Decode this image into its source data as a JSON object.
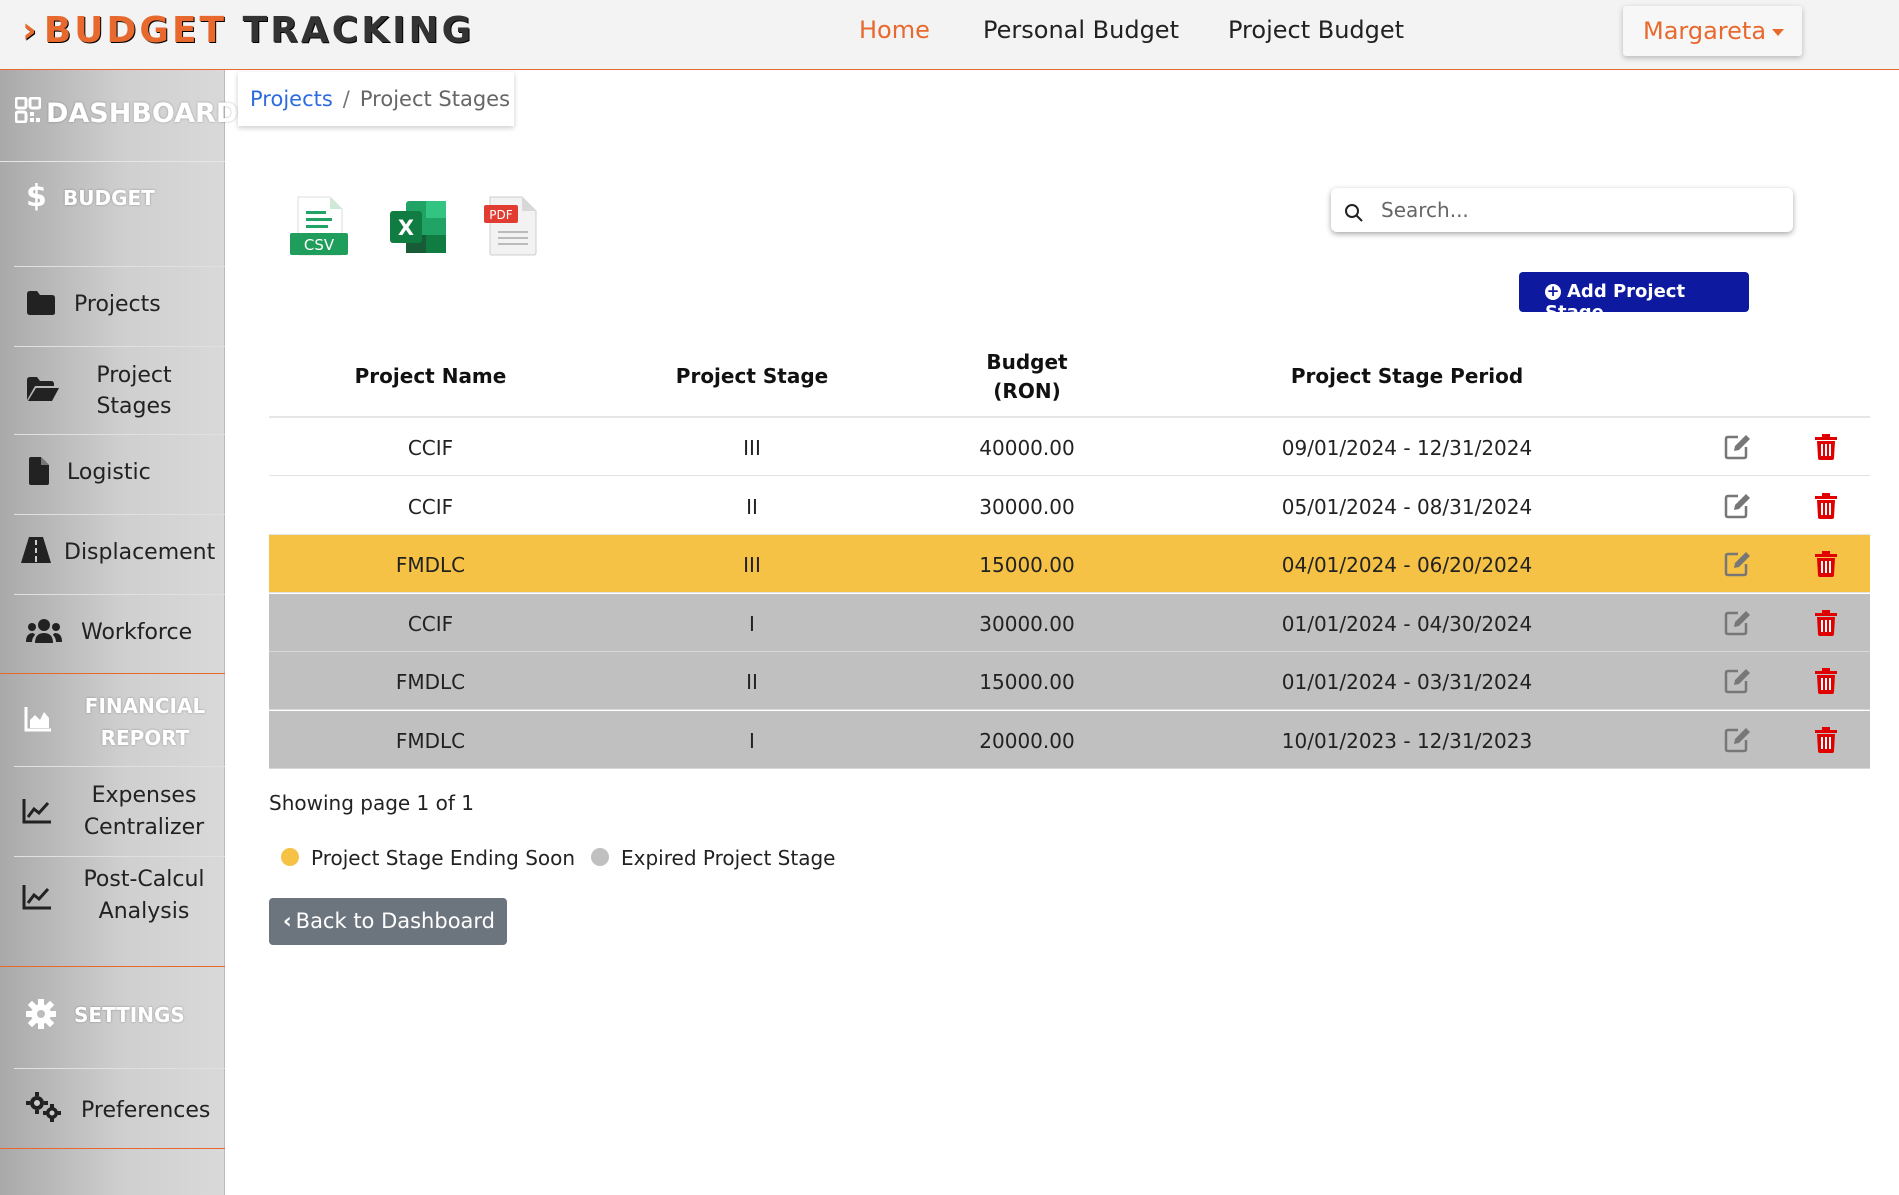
{
  "header": {
    "logo_prefix": "BUDGET",
    "logo_suffix": "TRACKING",
    "nav": {
      "home": "Home",
      "personal": "Personal Budget",
      "project": "Project Budget"
    },
    "user": "Margareta"
  },
  "sidebar": {
    "dashboard": "DASHBOARD",
    "budget_section": "BUDGET",
    "items_budget": [
      "Projects",
      "Project Stages",
      "Logistic",
      "Displacement",
      "Workforce"
    ],
    "financial_section": "FINANCIAL REPORT",
    "items_financial": [
      "Expenses Centralizer",
      "Post-Calcul Analysis"
    ],
    "settings_section": "SETTINGS",
    "items_settings": [
      "Preferences"
    ]
  },
  "breadcrumb": {
    "link": "Projects",
    "separator": "/",
    "current": "Project Stages"
  },
  "export": {
    "csv": "CSV",
    "pdf": "PDF",
    "excel": "X"
  },
  "search": {
    "placeholder": "Search..."
  },
  "add_button": "Add Project Stage",
  "table": {
    "headers": {
      "name": "Project Name",
      "stage": "Project Stage",
      "budget_line1": "Budget",
      "budget_line2": "(RON)",
      "period": "Project Stage Period"
    },
    "rows": [
      {
        "name": "CCIF",
        "stage": "III",
        "budget": "40000.00",
        "period": "09/01/2024 - 12/31/2024",
        "status": "normal"
      },
      {
        "name": "CCIF",
        "stage": "II",
        "budget": "30000.00",
        "period": "05/01/2024 - 08/31/2024",
        "status": "normal"
      },
      {
        "name": "FMDLC",
        "stage": "III",
        "budget": "15000.00",
        "period": "04/01/2024 - 06/20/2024",
        "status": "soon"
      },
      {
        "name": "CCIF",
        "stage": "I",
        "budget": "30000.00",
        "period": "01/01/2024 - 04/30/2024",
        "status": "expired"
      },
      {
        "name": "FMDLC",
        "stage": "II",
        "budget": "15000.00",
        "period": "01/01/2024 - 03/31/2024",
        "status": "expired"
      },
      {
        "name": "FMDLC",
        "stage": "I",
        "budget": "20000.00",
        "period": "10/01/2023 - 12/31/2023",
        "status": "expired"
      }
    ]
  },
  "pagination_text": "Showing page 1 of 1",
  "legend": {
    "soon": "Project Stage Ending Soon",
    "expired": "Expired Project Stage"
  },
  "back_button": "Back to Dashboard",
  "colors": {
    "accent": "#e8692e",
    "soon": "#f5c246",
    "expired": "#c0c0c0",
    "primary_button": "#0d1aa0",
    "delete": "#e00000"
  }
}
